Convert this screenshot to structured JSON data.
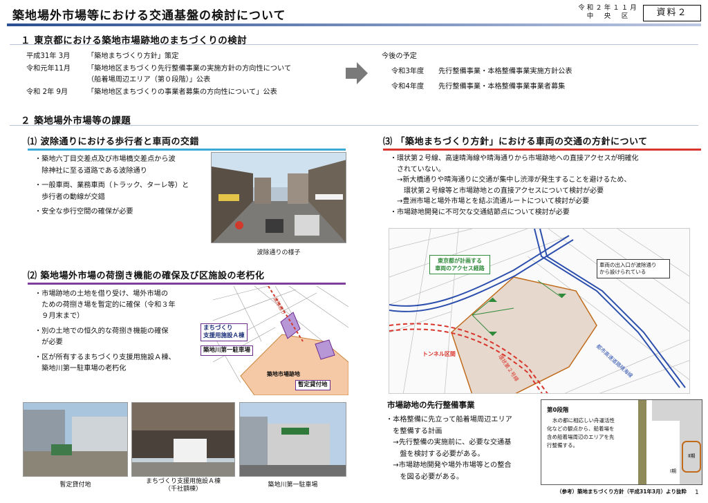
{
  "header": {
    "title": "築地場外市場等における交通基盤の検討について",
    "date_line1": "令和２年１１月",
    "date_line2": "中　央　区",
    "doc_number": "資料２"
  },
  "section1": {
    "heading": "１ 東京都における築地市場跡地のまちづくりの検討",
    "history": [
      {
        "date": "平成31年 3月",
        "text": "「築地まちづくり方針」策定"
      },
      {
        "date": "令和元年11月",
        "text": "「築地地区まちづくり先行整備事業の実施方針の方向性について"
      },
      {
        "date": "",
        "text": "（船着場周辺エリア（第０段階）」公表"
      },
      {
        "date": "令和 2年 9月",
        "text": "「築地地区まちづくりの事業者募集の方向性について」公表"
      }
    ],
    "future_heading": "今後の予定",
    "future": [
      {
        "date": "令和3年度",
        "text": "先行整備事業・本格整備事業実施方針公表"
      },
      {
        "date": "令和4年度",
        "text": "先行整備事業・本格整備事業事業者募集"
      }
    ]
  },
  "section2": {
    "heading": "２ 築地場外市場等の課題",
    "sub1": {
      "heading": "⑴ 波除通りにおける歩行者と車両の交錯",
      "bullets": [
        "・築地六丁目交差点及び市場橋交差点から波",
        "　除神社に至る道路である波除通り",
        "・一般車両、業務車両（トラック、ターレ等）と",
        "　歩行者の動線が交錯",
        "・安全な歩行空間の確保が必要"
      ],
      "photo_caption": "波除通りの様子"
    },
    "sub2": {
      "heading": "⑵ 築地場外市場の荷捌き機能の確保及び区施設の老朽化",
      "bullets": [
        "・市場跡地の土地を借り受け、場外市場の",
        "　ための荷捌き場を暫定的に確保（令和３年",
        "　９月末まで）",
        "・別の土地での恒久的な荷捌き機能の確保",
        "　が必要",
        "・区が所有するまちづくり支援用施設Ａ棟、",
        "　築地川第一駐車場の老朽化"
      ],
      "map_labels": {
        "building_a_line1": "まちづくり",
        "building_a_line2": "支援用施設Ａ棟",
        "parking": "築地川第一駐車場",
        "temp_land": "暫定貸付地",
        "site": "築地市場跡地",
        "street": "波除通り"
      },
      "photo_captions": [
        "暫定貸付地",
        "まちづくり支援用施設Ａ棟",
        "（千社額棟）",
        "築地川第一駐車場"
      ]
    },
    "sub3": {
      "heading": "⑶ 「築地まちづくり方針」における車両の交通の方針について",
      "bullets": [
        "・環状第２号線、高速晴海線や晴海通りから市場跡地への直接アクセスが明確化",
        "　されていない。",
        "　→新大橋通りや晴海通りに交通が集中し渋滞が発生することを避けるため、",
        "　　環状第２号線等と市場跡地との直接アクセスについて検討が必要",
        "　→豊洲市場と場外市場とを結ぶ流通ルートについて検討が必要",
        "・市場跡地開発に不可欠な交通結節点について検討が必要"
      ],
      "map_callout_left_1": "東京都が計画する",
      "map_callout_left_2": "車両のアクセス経路",
      "map_callout_right_1": "車両の出入口が波除通り",
      "map_callout_right_2": "から設けられている",
      "map_tunnel": "トンネル区間",
      "map_ring": "環状第２号線",
      "map_highway": "都市高速道路晴海線"
    },
    "sub4": {
      "heading": "市場跡地の先行整備事業",
      "bullets": [
        "・本格整備に先立って船着場周辺エリア",
        "　を整備する計画",
        "　→先行整備の実施前に、必要な交通基",
        "　　盤を検討する必要がある。",
        "　→市場跡地開発や場外市場等との整合",
        "　　を図る必要がある。"
      ],
      "stage_title": "第0段階",
      "stage_text": [
        "水の都に相応しい舟運活性",
        "化などの観点から、船着場を",
        "含め船着場周辺のエリアを先",
        "行整備する。"
      ],
      "stage_labels": [
        "Ⅱ期",
        "Ⅰ期"
      ],
      "reference": "（参考）築地まちづくり方針（平成31年3月）より抜粋"
    }
  },
  "page_number": "1"
}
